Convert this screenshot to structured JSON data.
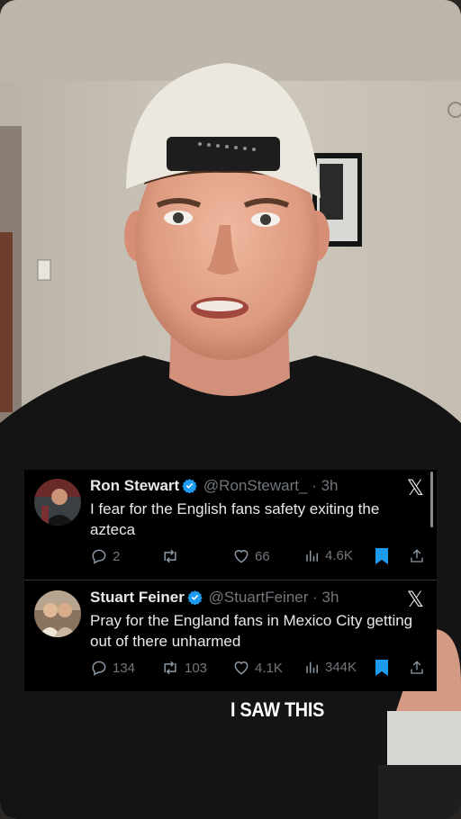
{
  "tweets": [
    {
      "name": "Ron Stewart",
      "handle": "@RonStewart_",
      "time": "· 3h",
      "text": "I fear for the English fans safety exiting the azteca",
      "replies": "2",
      "retweets": "",
      "likes": "66",
      "views": "4.6K",
      "verified": true
    },
    {
      "name": "Stuart Feiner",
      "handle": "@StuartFeiner",
      "time": "· 3h",
      "text": "Pray for the England fans in Mexico City getting out of there unharmed",
      "replies": "134",
      "retweets": "103",
      "likes": "4.1K",
      "views": "344K",
      "verified": true
    }
  ],
  "x_logo": "𝕏",
  "caption": "I SAW THIS",
  "colors": {
    "verified_blue": "#1d9bf0",
    "bookmark_blue": "#1d9bf0",
    "panel_bg": "#000000",
    "muted_text": "#71767b"
  },
  "icons": [
    "reply-icon",
    "retweet-icon",
    "like-icon",
    "views-icon",
    "bookmark-icon",
    "share-icon",
    "verified-badge-icon",
    "x-logo-icon"
  ]
}
